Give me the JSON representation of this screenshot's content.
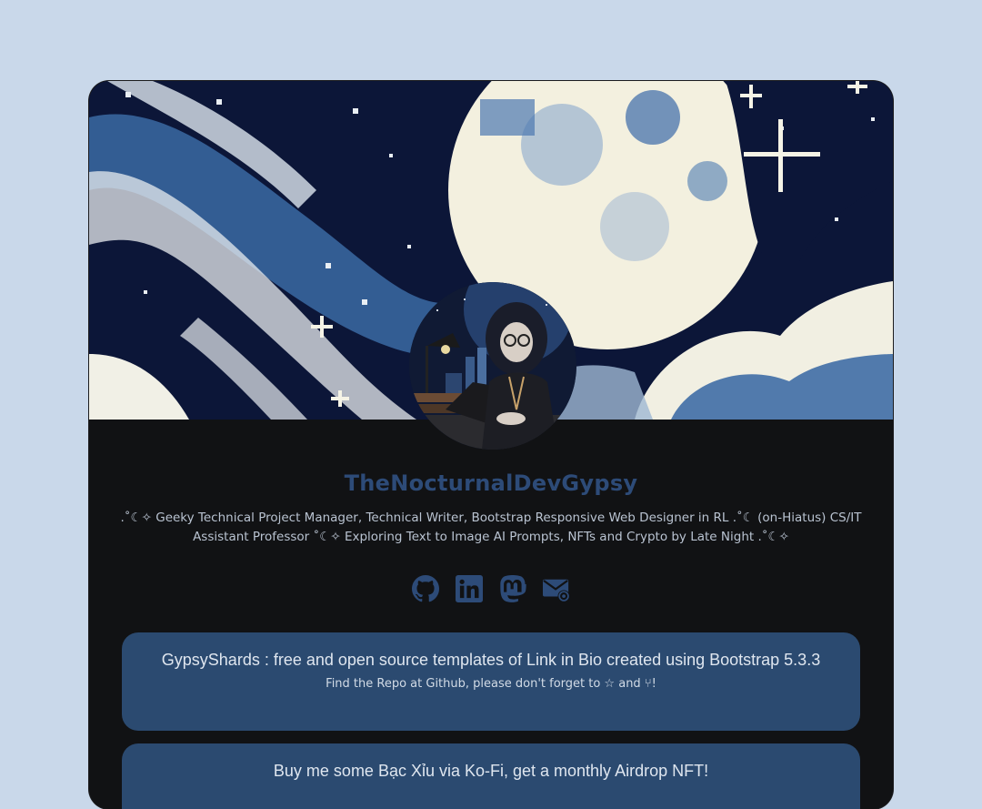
{
  "profile": {
    "name": "TheNocturnalDevGypsy",
    "bio": ".˚☾✧ Geeky Technical Project Manager, Technical Writer, Bootstrap Responsive Web Designer in RL .˚☾ (on-Hiatus) CS/IT Assistant Professor ˚☾✧ Exploring Text to Image AI Prompts, NFTs and Crypto by Late Night .˚☾✧"
  },
  "socials": [
    {
      "icon": "github-icon"
    },
    {
      "icon": "linkedin-icon"
    },
    {
      "icon": "mastodon-icon"
    },
    {
      "icon": "email-icon"
    }
  ],
  "links": [
    {
      "title": "GypsyShards : free and open source templates of Link in Bio created using Bootstrap 5.3.3",
      "subtitle": "Find the Repo at Github, please don't forget to ☆ and ⑂!"
    },
    {
      "title": "Buy me some Bạc Xỉu via Ko-Fi, get a monthly Airdrop NFT!"
    }
  ],
  "colors": {
    "page_bg": "#c9d8ea",
    "card_bg": "#111214",
    "accent": "#2b4a70",
    "name": "#2d4b78"
  }
}
